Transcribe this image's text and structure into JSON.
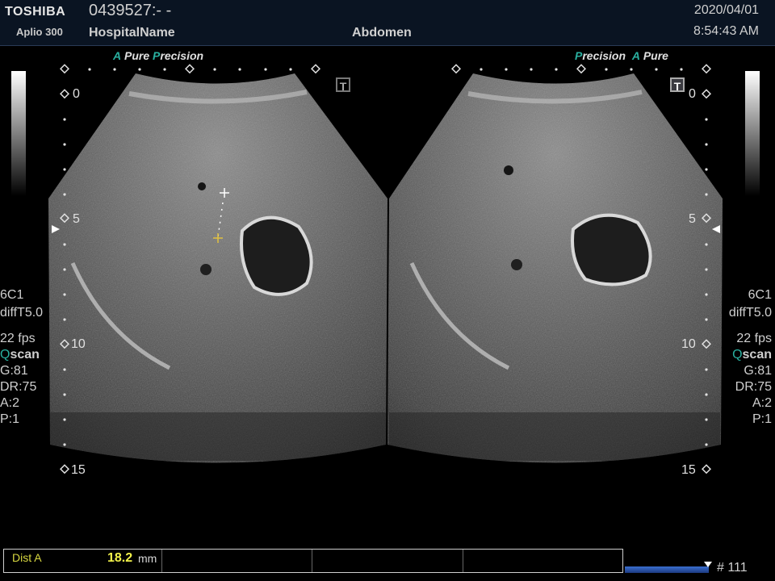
{
  "header": {
    "brand": "TOSHIBA",
    "model": "Aplio 300",
    "patient_id": "0439527:- -",
    "hospital": "HospitalName",
    "preset": "Abdomen",
    "date": "2020/04/01",
    "time": "8:54:43 AM"
  },
  "left_image": {
    "mode_prefix": "A",
    "mode_pure": "Pure",
    "mode_p": "P",
    "mode_rest": "recision",
    "depth_labels": [
      "0",
      "5",
      "10",
      "15"
    ]
  },
  "right_image": {
    "mode_p": "P",
    "mode_rest": "recision",
    "mode_prefix": "A",
    "mode_pure": "Pure",
    "depth_labels": [
      "0",
      "5",
      "10",
      "15"
    ]
  },
  "params": {
    "probe": "6C1",
    "harmonic": "diffT5.0",
    "fps": "22 fps",
    "qscan_q": "Q",
    "qscan_rest": "scan",
    "gain": "G:81",
    "dr": "DR:75",
    "a": "A:2",
    "p": "P:1"
  },
  "measurement": {
    "label": "Dist A",
    "value": "18.2",
    "unit": "mm"
  },
  "frame_counter": "# 111",
  "colors": {
    "accent": "#2ab0a0",
    "measure": "#f2f24a",
    "header_bg": "#0a1422"
  }
}
